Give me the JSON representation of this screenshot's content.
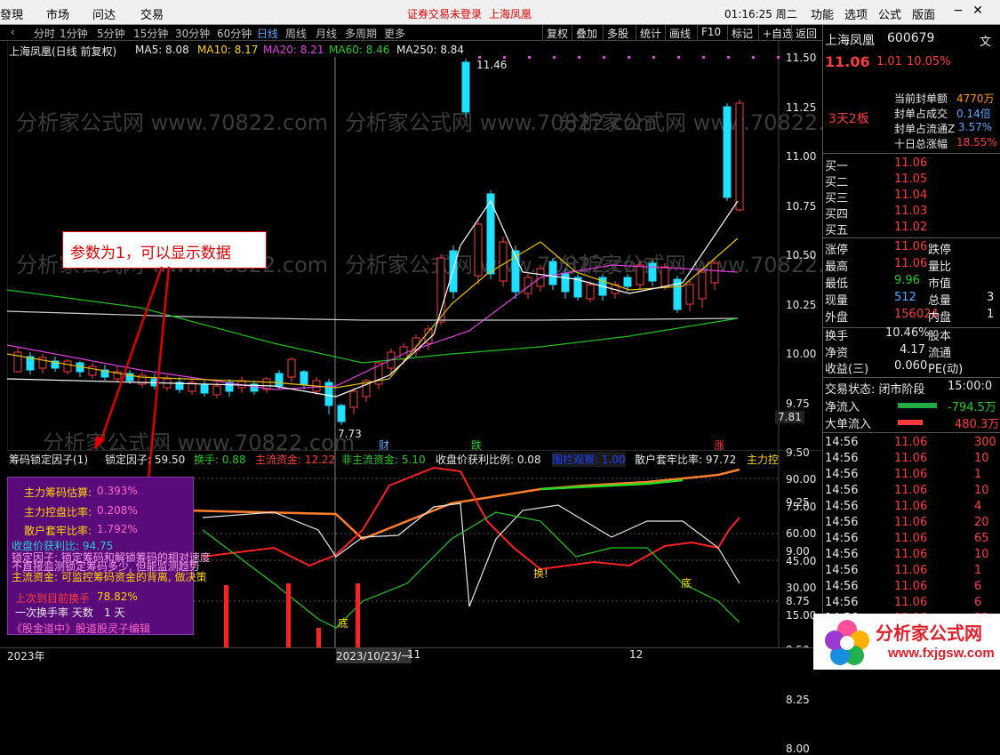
{
  "menubar": {
    "items": [
      "發現",
      "市场",
      "问达",
      "交易"
    ],
    "notice": "证券交易未登录",
    "stock_link": "上海凤凰",
    "clock": "01:16:25 周二",
    "right_items": [
      "功能",
      "选项",
      "公式",
      "版面"
    ]
  },
  "toolbar": {
    "periods": [
      "分时",
      "1分钟",
      "5分钟",
      "15分钟",
      "30分钟",
      "60分钟",
      "日线",
      "周线",
      "月线",
      "多周期",
      "更多"
    ],
    "active_period": "日线",
    "right_buttons": [
      "复权",
      "叠加",
      "多股",
      "统计",
      "画线",
      "F10",
      "标记",
      "+自选",
      "返回"
    ]
  },
  "chart_header": {
    "title": "上海凤凰(日线 前复权)",
    "ma5": "MA5: 8.08",
    "ma10": "MA10: 8.17",
    "ma20": "MA20: 8.21",
    "ma60": "MA60: 8.46",
    "ma250": "MA250: 8.84"
  },
  "price_axis": [
    "11.50",
    "11.25",
    "11.00",
    "10.75",
    "10.50",
    "10.25",
    "10.00",
    "9.75",
    "9.50",
    "9.25",
    "9.00",
    "8.75",
    "8.50",
    "8.25",
    "8.00"
  ],
  "price_marker": "7.81",
  "annotations": {
    "high": "11.46",
    "low": "7.73",
    "cai": "财",
    "die": "跌",
    "zhang": "涨"
  },
  "watermark": "分析家公式网 www.70822.com",
  "callout": "参数为1，可以显示数据",
  "indicator_header": {
    "name": "筹码锁定因子(1)",
    "lock": "锁定因子: 59.50",
    "turnover": "换手: 0.88",
    "main_funds": "主流资金: 12.22",
    "non_main": "非主流资金: 5.10",
    "profit_ratio": "收盘价获利比例: 0.08",
    "fence": "围栏观察: 1.00",
    "retail": "散户套牢比率: 97.72",
    "main_ctrl": "主力控"
  },
  "indicator_axis": [
    "90.00",
    "75.00",
    "60.00",
    "45.00",
    "30.00",
    "15.00"
  ],
  "indicator_labels": {
    "huan1": "换!",
    "di1": "底",
    "di2": "底"
  },
  "overlay": {
    "l1": "主力筹码估算:",
    "v1": "0.393%",
    "l2": "主力控盘比率:",
    "v2": "0.208%",
    "l3": "散户套牢比率:",
    "v3": "1.792%",
    "l4": "收盘价获利比: 94.75",
    "l5": "锁定因子: 锁定筹码和解锁筹码的相对速度",
    "l6": "不直接监测锁定筹码多少, 但能监测趋势",
    "l7": "主流资金: 可监控筹码资金的背离, 做决策",
    "l8": "上次到目前换手",
    "v8": "78.82%",
    "l9": "一次换手率 天数",
    "v9": "1 天",
    "l10": "《股金道中》股道股灵子编辑"
  },
  "statusbar": {
    "year": "2023年",
    "date": "2023/10/23/一",
    "day": "11",
    "month_mark": "12"
  },
  "quote": {
    "name": "上海凤凰",
    "code": "600679",
    "side_label": "文",
    "price": "11.06",
    "change": "1.01",
    "pct": "10.05%",
    "limit_tag": "3天2板",
    "seal_amount_label": "当前封单额",
    "seal_amount": "4770万",
    "seal_turnover_label": "封单占成交",
    "seal_turnover": "0.14倍",
    "seal_float_label": "封单占流通Z",
    "seal_float": "3.57%",
    "ten_day_label": "十日总涨幅",
    "ten_day": "18.55%",
    "bids": [
      {
        "label": "买一",
        "price": "11.06"
      },
      {
        "label": "买二",
        "price": "11.05"
      },
      {
        "label": "买三",
        "price": "11.04"
      },
      {
        "label": "买四",
        "price": "11.03"
      },
      {
        "label": "买五",
        "price": "11.02"
      }
    ],
    "stats": [
      {
        "l1": "涨停",
        "v1": "11.06",
        "l2": "跌停"
      },
      {
        "l1": "最高",
        "v1": "11.06",
        "l2": "量比"
      },
      {
        "l1": "最低",
        "v1": "9.96",
        "l2": "市值"
      },
      {
        "l1": "现量",
        "v1": "512",
        "l2": "总量",
        "v2": "3"
      },
      {
        "l1": "外盘",
        "v1": "156024",
        "l2": "内盘",
        "v2": "1"
      }
    ],
    "huanshou_label": "换手",
    "huanshou": "10.46%",
    "guben": "股本",
    "jingzi_label": "净资",
    "jingzi": "4.17",
    "liutong": "流通",
    "shouyi_label": "收益(三)",
    "shouyi": "0.060",
    "pe": "PE(动)",
    "status_label": "交易状态: 闭市阶段",
    "status_time": "15:00:0",
    "net_inflow_label": "净流入",
    "net_inflow": "-794.5万",
    "big_inflow_label": "大单流入",
    "big_inflow": "480.3万",
    "ticks": [
      {
        "t": "14:56",
        "p": "11.06",
        "v": "300"
      },
      {
        "t": "14:56",
        "p": "11.06",
        "v": "10"
      },
      {
        "t": "14:56",
        "p": "11.06",
        "v": "1"
      },
      {
        "t": "14:56",
        "p": "11.06",
        "v": "10"
      },
      {
        "t": "14:56",
        "p": "11.06",
        "v": "4"
      },
      {
        "t": "14:56",
        "p": "11.06",
        "v": "20"
      },
      {
        "t": "14:56",
        "p": "11.06",
        "v": "65"
      },
      {
        "t": "14:56",
        "p": "11.06",
        "v": "10"
      },
      {
        "t": "14:56",
        "p": "11.06",
        "v": "1"
      },
      {
        "t": "14:56",
        "p": "11.06",
        "v": "6"
      },
      {
        "t": "14:56",
        "p": "11.06",
        "v": "6"
      },
      {
        "t": "14:56",
        "p": "11.06",
        "v": "22"
      }
    ]
  },
  "logo": {
    "text": "分析家公式网",
    "url": "www.fxjgsw.com"
  },
  "colors": {
    "up": "#ff3b3b",
    "down": "#20e0ff",
    "ma5": "#ffffff",
    "ma10": "#e6c200",
    "ma20": "#e040e0",
    "ma60": "#20c020",
    "ma250": "#d0d0d0"
  }
}
